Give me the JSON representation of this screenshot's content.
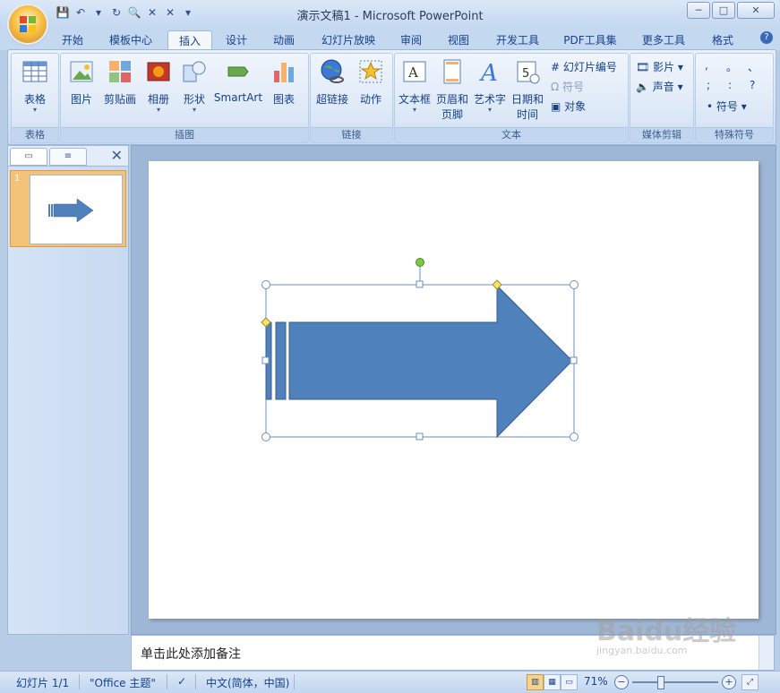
{
  "window": {
    "title": "演示文稿1 - Microsoft PowerPoint",
    "controls": [
      "─",
      "□",
      "✕"
    ]
  },
  "qat": [
    "💾",
    "↶",
    "▾",
    "↻",
    "🔍",
    "✕",
    "✕",
    "▾"
  ],
  "tabs": [
    {
      "label": "开始"
    },
    {
      "label": "模板中心"
    },
    {
      "label": "插入",
      "active": true
    },
    {
      "label": "设计"
    },
    {
      "label": "动画"
    },
    {
      "label": "幻灯片放映"
    },
    {
      "label": "审阅"
    },
    {
      "label": "视图"
    },
    {
      "label": "开发工具"
    },
    {
      "label": "PDF工具集"
    },
    {
      "label": "更多工具"
    },
    {
      "label": "格式"
    }
  ],
  "help": "?",
  "ribbon": {
    "groups": {
      "table": "表格",
      "illustrations": "插图",
      "links": "链接",
      "text": "文本",
      "media": "媒体剪辑",
      "symbols": "特殊符号"
    },
    "buttons": {
      "table": "表格",
      "picture": "图片",
      "clipart": "剪贴画",
      "album": "相册",
      "shapes": "形状",
      "smartart": "SmartArt",
      "chart": "图表",
      "hyperlink": "超链接",
      "action": "动作",
      "textbox": "文本框",
      "header_1": "页眉和",
      "header_2": "页脚",
      "wordart": "艺术字",
      "datetime_1": "日期和",
      "datetime_2": "时间",
      "slide_number": "幻灯片编号",
      "symbol": "符号",
      "object": "对象",
      "movie": "影片",
      "sound": "声音",
      "symbols_btn": "符号",
      "punct": [
        ",",
        "。",
        "、",
        ";",
        ":",
        "?"
      ]
    }
  },
  "pane": {
    "slide_number": "1"
  },
  "notes_placeholder": "单击此处添加备注",
  "status": {
    "slide": "幻灯片 1/1",
    "theme": "\"Office 主题\"",
    "language": "中文(简体，中国)",
    "zoom": "71%"
  },
  "watermark": {
    "main": "Baidu经验",
    "sub": "jingyan.baidu.com"
  },
  "colors": {
    "arrow_fill": "#4f81bd",
    "arrow_stroke": "#385d8a",
    "handle_yellow": "#f5e66a",
    "handle_green": "#7cc843"
  }
}
